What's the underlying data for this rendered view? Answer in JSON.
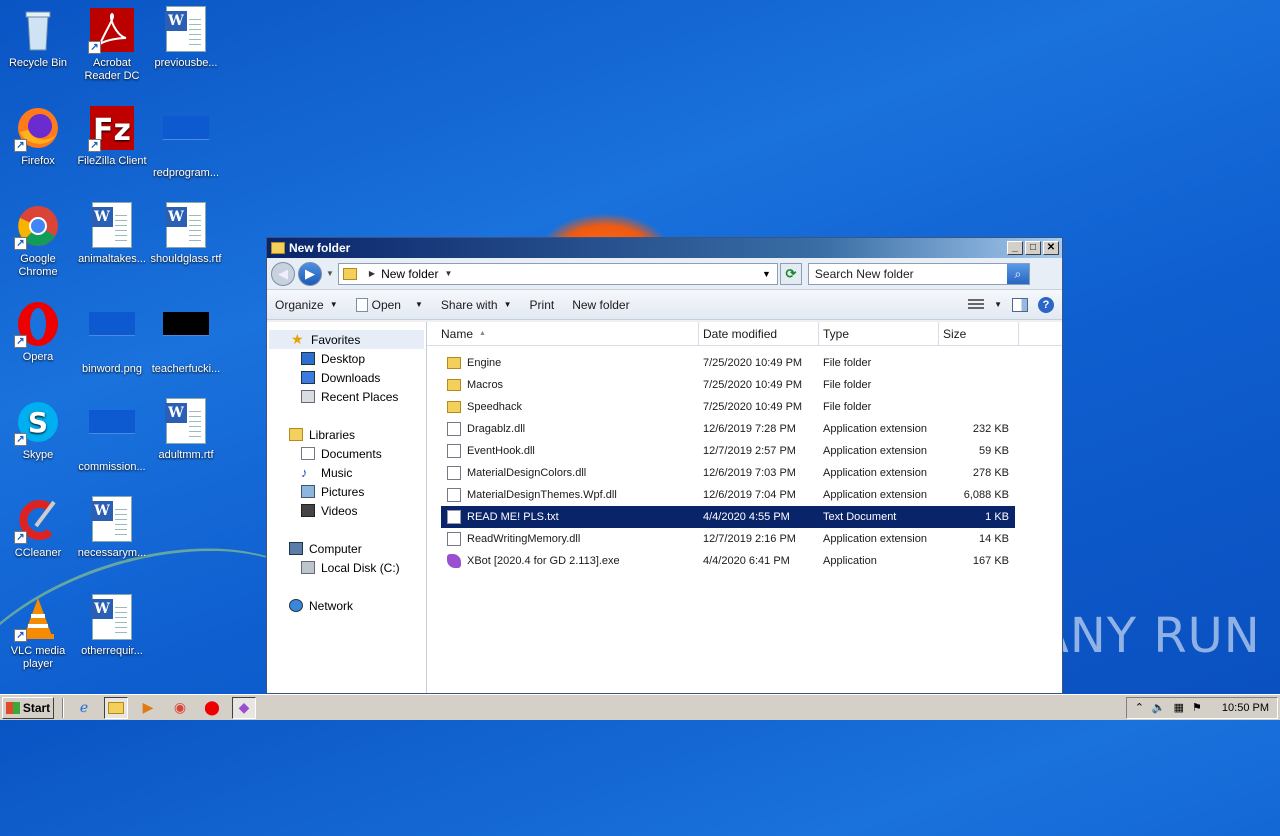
{
  "desktop": {
    "icons": [
      {
        "label": "Recycle Bin"
      },
      {
        "label": "Acrobat Reader DC"
      },
      {
        "label": "previousbe..."
      },
      {
        "label": "Firefox"
      },
      {
        "label": "FileZilla Client"
      },
      {
        "label": "redprogram..."
      },
      {
        "label": "Google Chrome"
      },
      {
        "label": "animaltakes..."
      },
      {
        "label": "shouldglass.rtf"
      },
      {
        "label": "Opera"
      },
      {
        "label": "binword.png"
      },
      {
        "label": "teacherfucki..."
      },
      {
        "label": "Skype"
      },
      {
        "label": "commission..."
      },
      {
        "label": "adultmm.rtf"
      },
      {
        "label": "CCleaner"
      },
      {
        "label": "necessarym..."
      },
      {
        "label": "VLC media player"
      },
      {
        "label": "otherrequir..."
      }
    ],
    "watermark": "ANY RUN"
  },
  "window": {
    "title": "New folder",
    "address": {
      "folder": "New folder"
    },
    "search": {
      "placeholder": "Search New folder"
    },
    "toolbar": {
      "organize": "Organize",
      "open": "Open",
      "share_with": "Share with",
      "print": "Print",
      "new_folder": "New folder"
    },
    "nav": {
      "favorites": "Favorites",
      "desktop": "Desktop",
      "downloads": "Downloads",
      "recent_places": "Recent Places",
      "libraries": "Libraries",
      "documents": "Documents",
      "music": "Music",
      "pictures": "Pictures",
      "videos": "Videos",
      "computer": "Computer",
      "local_disk": "Local Disk (C:)",
      "network": "Network"
    },
    "columns": {
      "name": "Name",
      "date": "Date modified",
      "type": "Type",
      "size": "Size"
    },
    "files": [
      {
        "name": "Engine",
        "date": "7/25/2020 10:49 PM",
        "type": "File folder",
        "size": "",
        "icon": "folder"
      },
      {
        "name": "Macros",
        "date": "7/25/2020 10:49 PM",
        "type": "File folder",
        "size": "",
        "icon": "folder"
      },
      {
        "name": "Speedhack",
        "date": "7/25/2020 10:49 PM",
        "type": "File folder",
        "size": "",
        "icon": "folder"
      },
      {
        "name": "Dragablz.dll",
        "date": "12/6/2019 7:28 PM",
        "type": "Application extension",
        "size": "232 KB",
        "icon": "dll"
      },
      {
        "name": "EventHook.dll",
        "date": "12/7/2019 2:57 PM",
        "type": "Application extension",
        "size": "59 KB",
        "icon": "dll"
      },
      {
        "name": "MaterialDesignColors.dll",
        "date": "12/6/2019 7:03 PM",
        "type": "Application extension",
        "size": "278 KB",
        "icon": "dll"
      },
      {
        "name": "MaterialDesignThemes.Wpf.dll",
        "date": "12/6/2019 7:04 PM",
        "type": "Application extension",
        "size": "6,088 KB",
        "icon": "dll"
      },
      {
        "name": "READ ME! PLS.txt",
        "date": "4/4/2020 4:55 PM",
        "type": "Text Document",
        "size": "1 KB",
        "icon": "txt",
        "selected": true
      },
      {
        "name": "ReadWritingMemory.dll",
        "date": "12/7/2019 2:16 PM",
        "type": "Application extension",
        "size": "14 KB",
        "icon": "dll"
      },
      {
        "name": "XBot [2020.4 for GD 2.113].exe",
        "date": "4/4/2020 6:41 PM",
        "type": "Application",
        "size": "167 KB",
        "icon": "exe"
      }
    ]
  },
  "taskbar": {
    "start": "Start",
    "clock": "10:50 PM"
  },
  "colors": {
    "selection": "#0a246a",
    "title_gradient_start": "#0a246a",
    "desktop": "#1a72dc"
  }
}
